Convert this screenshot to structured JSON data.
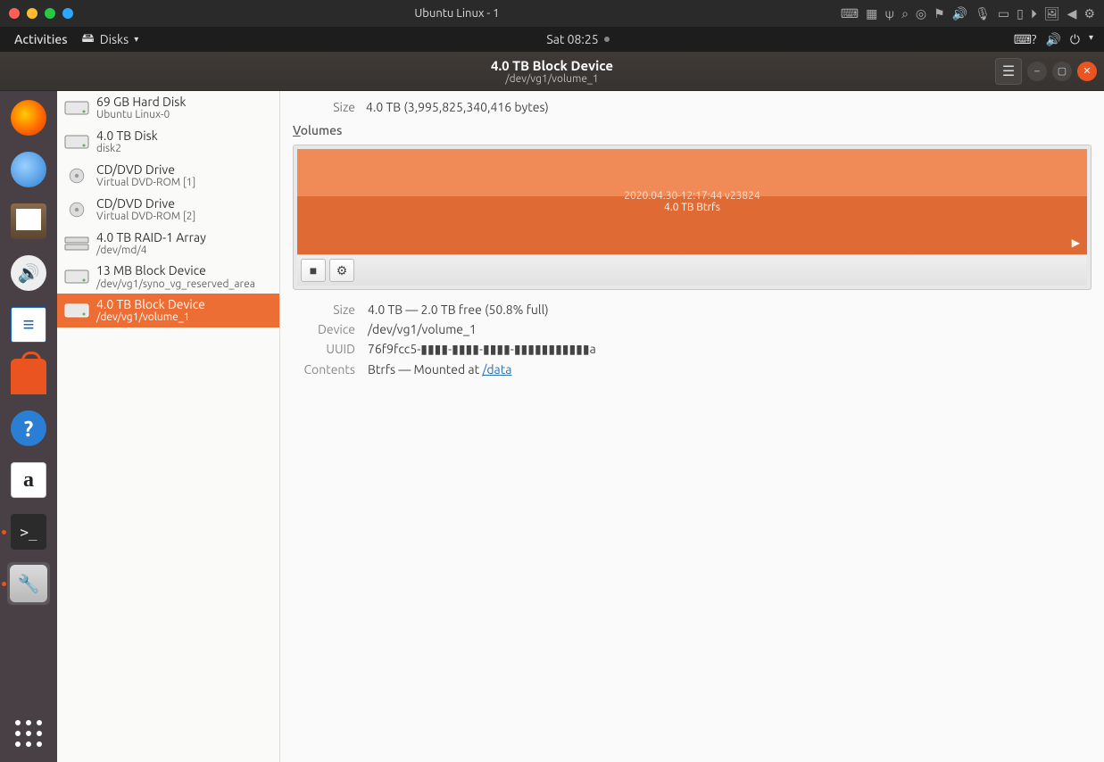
{
  "vm": {
    "title": "Ubuntu Linux - 1",
    "traffic": {
      "close": "#ff5f57",
      "min": "#febc2e",
      "max": "#28c840",
      "extra": "#2aa8ff"
    }
  },
  "topbar": {
    "activities": "Activities",
    "app_name": "Disks",
    "clock": "Sat 08:25"
  },
  "app": {
    "title": "4.0 TB Block Device",
    "subtitle": "/dev/vg1/volume_1"
  },
  "sidebar": {
    "items": [
      {
        "title": "69 GB Hard Disk",
        "sub": "Ubuntu Linux-0",
        "icon": "hdd"
      },
      {
        "title": "4.0 TB Disk",
        "sub": "disk2",
        "icon": "hdd"
      },
      {
        "title": "CD/DVD Drive",
        "sub": "Virtual DVD-ROM [1]",
        "icon": "optical"
      },
      {
        "title": "CD/DVD Drive",
        "sub": "Virtual DVD-ROM [2]",
        "icon": "optical"
      },
      {
        "title": "4.0 TB RAID-1 Array",
        "sub": "/dev/md/4",
        "icon": "raid"
      },
      {
        "title": "13 MB Block Device",
        "sub": "/dev/vg1/syno_vg_reserved_area",
        "icon": "block"
      },
      {
        "title": "4.0 TB Block Device",
        "sub": "/dev/vg1/volume_1",
        "icon": "block",
        "selected": true
      }
    ]
  },
  "overview": {
    "size_label": "Size",
    "size_value": "4.0 TB (3,995,825,340,416 bytes)"
  },
  "volumes": {
    "heading": "Volumes",
    "partition": {
      "name": "2020.04.30-12:17:44 v23824",
      "sub": "4.0 TB Btrfs"
    },
    "toolbar": {
      "unmount_tooltip": "Unmount",
      "gears_tooltip": "More actions"
    }
  },
  "details": {
    "rows": [
      {
        "label": "Size",
        "value": "4.0 TB — 2.0 TB free (50.8% full)"
      },
      {
        "label": "Device",
        "value": "/dev/vg1/volume_1"
      },
      {
        "label": "UUID",
        "value": "76f9fcc5-▮▮▮▮-▮▮▮▮-▮▮▮▮-▮▮▮▮▮▮▮▮▮▮▮a"
      }
    ],
    "contents_label": "Contents",
    "contents_prefix": "Btrfs — Mounted at ",
    "contents_link": "/data"
  },
  "dock": {
    "items": [
      "firefox",
      "thunderbird",
      "files",
      "rhythmbox",
      "writer",
      "software",
      "help",
      "amazon",
      "terminal",
      "disks"
    ]
  }
}
